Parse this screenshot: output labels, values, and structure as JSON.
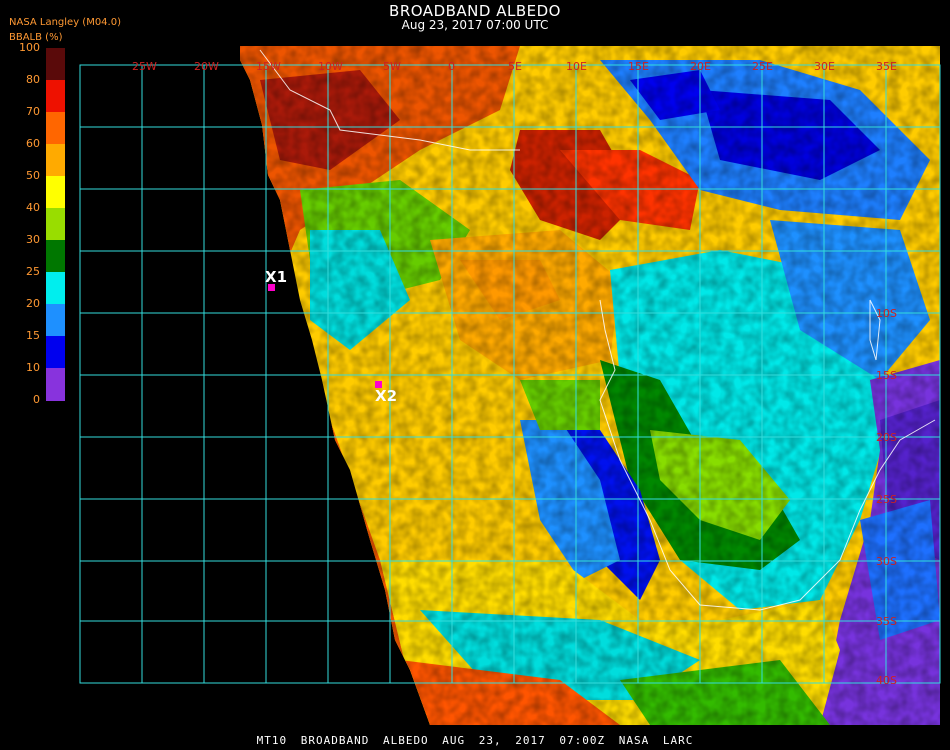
{
  "header": {
    "title": "BROADBAND ALBEDO",
    "subtitle": "Aug 23, 2017 07:00 UTC",
    "source": "NASA Langley (M04.0)",
    "unit": "BBALB (%)"
  },
  "colorbar": {
    "ticks": [
      "100",
      "80",
      "70",
      "60",
      "50",
      "40",
      "30",
      "25",
      "20",
      "15",
      "10",
      "0"
    ],
    "colors": [
      "#5a0a0a",
      "#ee1100",
      "#ff6600",
      "#ffaa00",
      "#ffff00",
      "#99dd00",
      "#007700",
      "#00eeee",
      "#1e90ff",
      "#0000ee",
      "#8833dd"
    ]
  },
  "grid": {
    "lon_labels": [
      "25W",
      "20W",
      "15W",
      "10W",
      "5W",
      "0",
      "5E",
      "10E",
      "15E",
      "20E",
      "25E",
      "30E",
      "35E"
    ],
    "lat_labels": [
      "10S",
      "15S",
      "20S",
      "25S",
      "30S",
      "35S",
      "40S"
    ]
  },
  "markers": [
    {
      "label": "X1",
      "color": "#ff00cc"
    },
    {
      "label": "X2",
      "color": "#ff00cc"
    }
  ],
  "footer": "MT10  BROADBAND ALBEDO   AUG 23, 2017 07:00Z   NASA LARC"
}
